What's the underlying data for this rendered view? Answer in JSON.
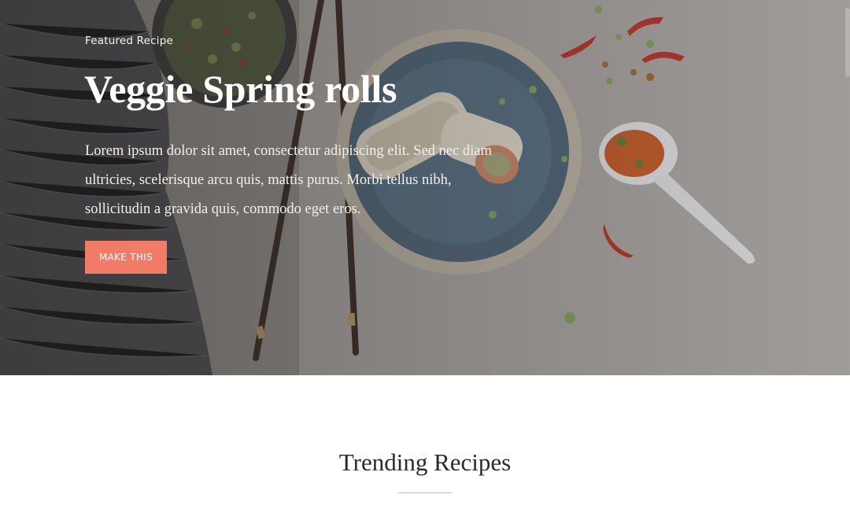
{
  "hero": {
    "eyebrow": "Featured Recipe",
    "title": "Veggie Spring rolls",
    "description": "Lorem ipsum dolor sit amet, consectetur adipiscing elit. Sed nec diam ultricies, scelerisque arcu quis, mattis purus. Morbi tellus nibh, sollicitudin a gravida quis, commodo eget eros.",
    "cta_label": "MAKE THIS",
    "cta_color": "#f27b67"
  },
  "trending": {
    "title": "Trending Recipes"
  }
}
